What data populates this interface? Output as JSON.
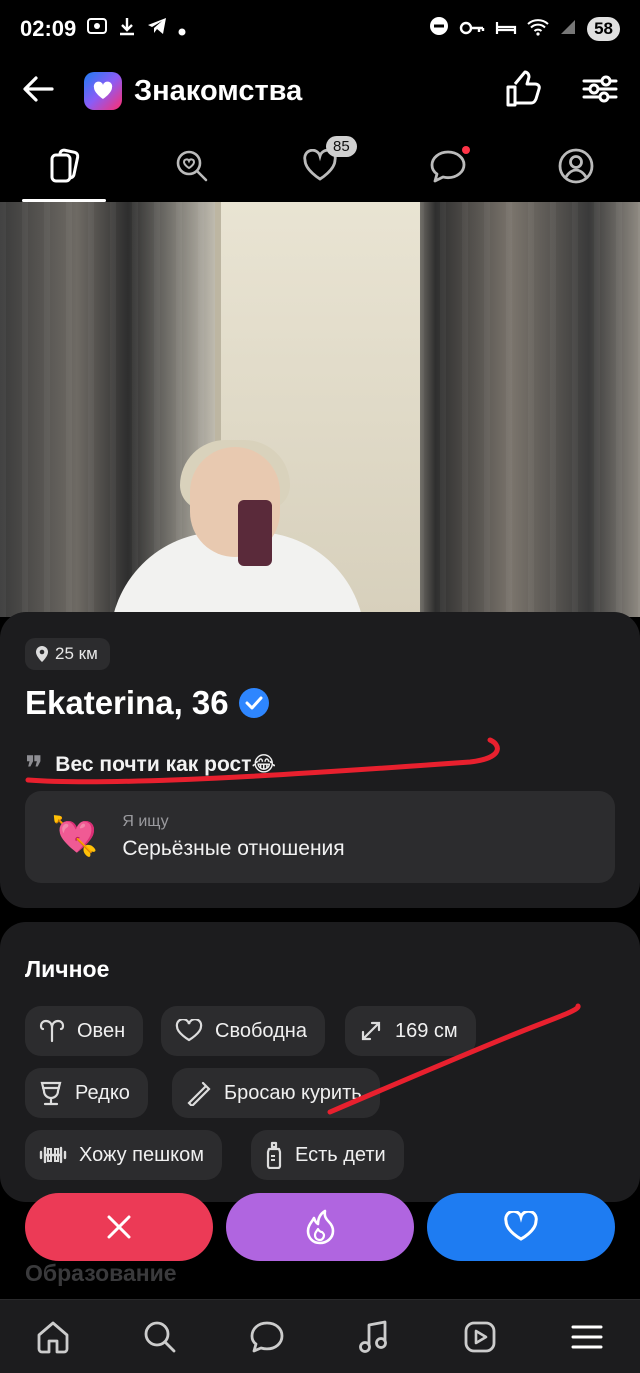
{
  "status_bar": {
    "time": "02:09",
    "battery": "58",
    "icons_left": [
      "screenshot-icon",
      "download-icon",
      "telegram-icon",
      "dot-icon"
    ],
    "icons_right": [
      "dnd-icon",
      "key-icon",
      "bed-icon",
      "wifi-icon",
      "signal-icon"
    ]
  },
  "header": {
    "title": "Знакомства",
    "back_icon": "arrow-left-icon",
    "right_icons": [
      "thumbs-up-icon",
      "filters-icon"
    ]
  },
  "tabs": [
    {
      "name": "cards",
      "icon": "cards-icon",
      "active": true
    },
    {
      "name": "search-likes",
      "icon": "heart-search-icon"
    },
    {
      "name": "likes",
      "icon": "heart-icon",
      "badge": "85"
    },
    {
      "name": "chats",
      "icon": "chat-icon",
      "dot": true
    },
    {
      "name": "profile",
      "icon": "profile-icon"
    }
  ],
  "profile": {
    "distance": "25 км",
    "name_age": "Ekaterina, 36",
    "verified": true,
    "quote": "Вес почти как рост😂",
    "looking_for_label": "Я ищу",
    "looking_for_value": "Серьёзные отношения",
    "looking_for_emoji": "💘"
  },
  "personal": {
    "title": "Личное",
    "chips": [
      {
        "label": "Овен",
        "icon": "aries-icon"
      },
      {
        "label": "Свободна",
        "icon": "heart-outline-icon"
      },
      {
        "label": "169 см",
        "icon": "height-icon"
      },
      {
        "label": "Редко",
        "icon": "wine-glass-icon"
      },
      {
        "label": "Бросаю курить",
        "icon": "cigarette-icon"
      },
      {
        "label": "Хожу пешком",
        "icon": "dumbbell-icon"
      },
      {
        "label": "Есть дети",
        "icon": "baby-bottle-icon"
      }
    ]
  },
  "next_section_title": "Образование",
  "actions": {
    "dislike_icon": "close-icon",
    "super_icon": "flame-icon",
    "like_icon": "heart-icon",
    "colors": {
      "dislike": "#ec3a56",
      "super": "#b065e0",
      "like": "#1e7cf2"
    }
  },
  "bottom_nav": [
    "home-icon",
    "search-icon",
    "messages-icon",
    "music-icon",
    "video-icon",
    "menu-icon"
  ],
  "annotation_color": "#e8202e"
}
